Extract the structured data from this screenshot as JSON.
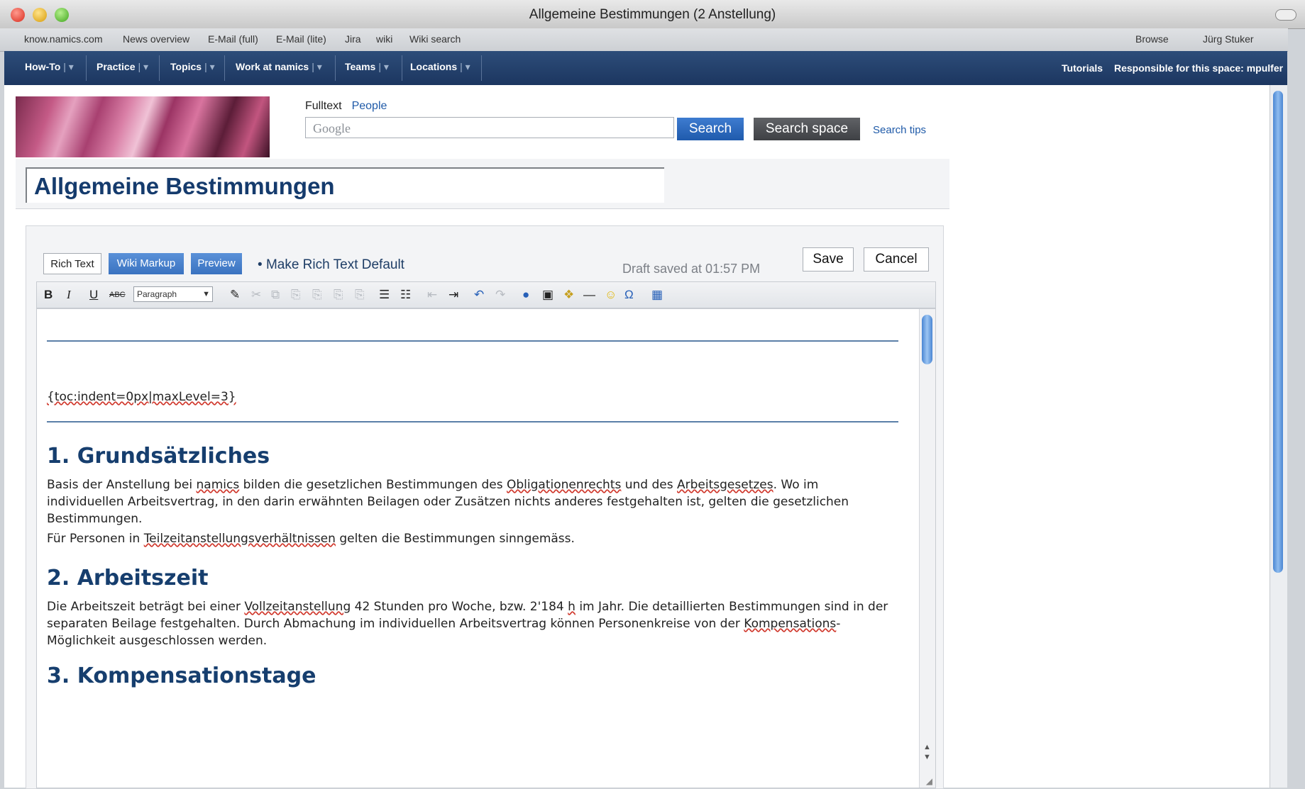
{
  "window": {
    "title": "Allgemeine Bestimmungen (2 Anstellung)"
  },
  "bookmarks": [
    "know.namics.com",
    "News overview",
    "E-Mail (full)",
    "E-Mail (lite)",
    "Jira",
    "wiki",
    "Wiki search"
  ],
  "bookmarks_right": {
    "browse": "Browse",
    "user": "Jürg Stuker"
  },
  "nav": {
    "items": [
      {
        "label": "How-To"
      },
      {
        "label": "Practice"
      },
      {
        "label": "Topics"
      },
      {
        "label": "Work at namics"
      },
      {
        "label": "Teams"
      },
      {
        "label": "Locations"
      }
    ],
    "tutorials": "Tutorials",
    "responsible": "Responsible for this space: mpulfer"
  },
  "search": {
    "tab_fulltext": "Fulltext",
    "tab_people": "People",
    "placeholder_logo": "Google",
    "search_label": "Search",
    "search_space_label": "Search space",
    "tips_label": "Search tips"
  },
  "page_title": "Allgemeine Bestimmungen",
  "editor": {
    "mode_rich": "Rich Text",
    "mode_wiki": "Wiki Markup",
    "mode_preview": "Preview",
    "make_default": "Make Rich Text Default",
    "draft_status": "Draft saved at 01:57 PM",
    "save_label": "Save",
    "cancel_label": "Cancel",
    "paragraph_style": "Paragraph"
  },
  "content": {
    "macro": "{toc:indent=0px|maxLevel=3}",
    "h1": "1. Grundsätzliches",
    "p1_a": "Basis der Anstellung bei ",
    "p1_b": "namics",
    "p1_c": " bilden die gesetzlichen Bestimmungen des ",
    "p1_d": "Obligationenrechts",
    "p1_e": " und des ",
    "p1_f": "Arbeitsgesetzes",
    "p1_g": ". Wo im individuellen Arbeitsvertrag, in den darin erwähnten Beilagen oder Zusätzen nichts anderes festgehalten ist, gelten die gesetzlichen Bestimmungen.",
    "p2_a": "Für Personen in ",
    "p2_b": "Teilzeitanstellungsverhältnissen",
    "p2_c": " gelten die Bestimmungen sinngemäss.",
    "h2": "2. Arbeitszeit",
    "p3_a": "Die Arbeitszeit beträgt bei einer ",
    "p3_b": "Vollzeitanstellung",
    "p3_c": " 42 Stunden pro Woche, bzw. 2'184 ",
    "p3_d": "h",
    "p3_e": " im Jahr. Die detaillierten Bestimmungen sind in der separaten Beilage festgehalten. Durch Abmachung im individuellen Arbeitsvertrag können Personenkreise von der ",
    "p3_f": "Kompensations",
    "p3_g": "-Möglichkeit ausgeschlossen werden.",
    "h3": "3. Kompensationstage"
  }
}
